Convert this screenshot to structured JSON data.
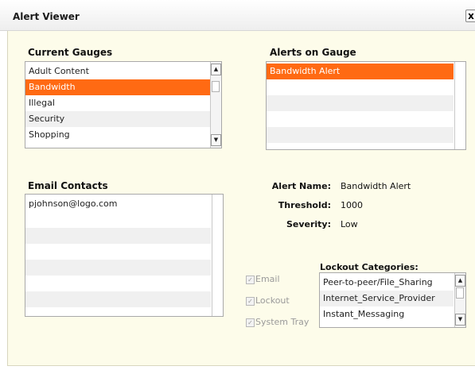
{
  "window": {
    "title": "Alert Viewer",
    "close_label": "x"
  },
  "gauges": {
    "heading": "Current Gauges",
    "items": [
      "Adult Content",
      "Bandwidth",
      "Illegal",
      "Security",
      "Shopping"
    ],
    "selected": "Bandwidth"
  },
  "alerts": {
    "heading": "Alerts on Gauge",
    "items": [
      "Bandwidth Alert"
    ],
    "selected": "Bandwidth Alert"
  },
  "contacts": {
    "heading": "Email Contacts",
    "items": [
      "pjohnson@logo.com"
    ]
  },
  "details": {
    "name_label": "Alert Name:",
    "name_value": "Bandwidth Alert",
    "threshold_label": "Threshold:",
    "threshold_value": "1000",
    "severity_label": "Severity:",
    "severity_value": "Low"
  },
  "actions": {
    "email_label": "Email",
    "lockout_label": "Lockout",
    "tray_label": "System Tray",
    "check_mark": "✓"
  },
  "lockout": {
    "heading": "Lockout Categories:",
    "items": [
      "Peer-to-peer/File_Sharing",
      "Internet_Service_Provider",
      "Instant_Messaging"
    ]
  },
  "colors": {
    "selection": "#ff6a13",
    "background": "#fdfcea"
  }
}
